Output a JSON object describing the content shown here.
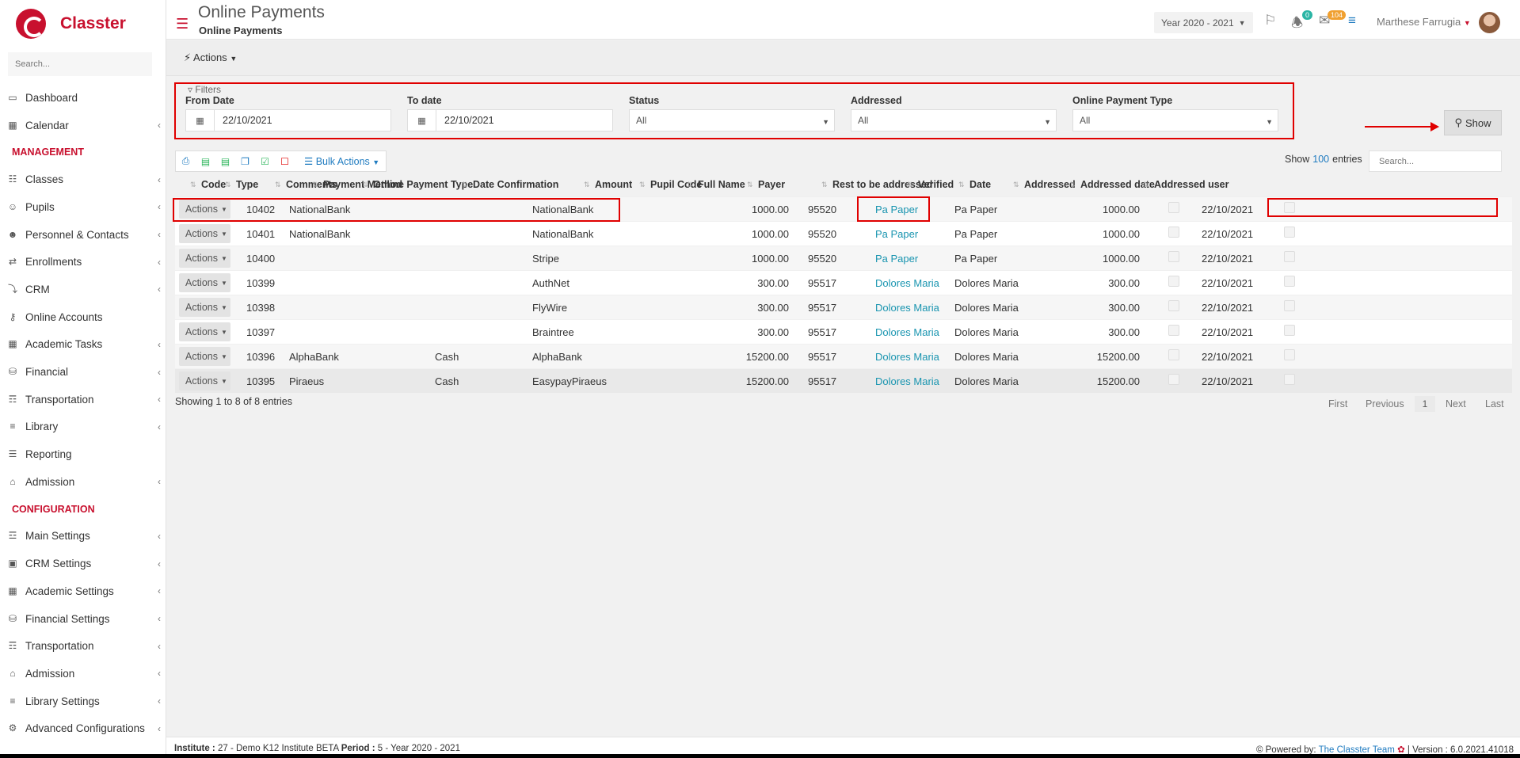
{
  "app": {
    "name": "Classter"
  },
  "sidebar": {
    "search_placeholder": "Search...",
    "management_title": "MANAGEMENT",
    "configuration_title": "CONFIGURATION",
    "items_top": [
      {
        "label": "Dashboard",
        "icon": "laptop-icon",
        "chev": false
      },
      {
        "label": "Calendar",
        "icon": "calendar-icon",
        "chev": true
      }
    ],
    "items_management": [
      {
        "label": "Classes",
        "icon": "classes-icon",
        "chev": true
      },
      {
        "label": "Pupils",
        "icon": "pupils-icon",
        "chev": true
      },
      {
        "label": "Personnel & Contacts",
        "icon": "personnel-icon",
        "chev": true
      },
      {
        "label": "Enrollments",
        "icon": "exchange-icon",
        "chev": true
      },
      {
        "label": "CRM",
        "icon": "crm-icon",
        "chev": true
      },
      {
        "label": "Online Accounts",
        "icon": "key-icon",
        "chev": false
      },
      {
        "label": "Academic Tasks",
        "icon": "grid-icon",
        "chev": true
      },
      {
        "label": "Financial",
        "icon": "coins-icon",
        "chev": true
      },
      {
        "label": "Transportation",
        "icon": "bus-icon",
        "chev": true
      },
      {
        "label": "Library",
        "icon": "books-icon",
        "chev": true
      },
      {
        "label": "Reporting",
        "icon": "report-icon",
        "chev": false
      },
      {
        "label": "Admission",
        "icon": "institution-icon",
        "chev": true
      }
    ],
    "items_configuration": [
      {
        "label": "Main Settings",
        "icon": "sliders-icon",
        "chev": true
      },
      {
        "label": "CRM Settings",
        "icon": "qr-icon",
        "chev": true
      },
      {
        "label": "Academic Settings",
        "icon": "grid-icon",
        "chev": true
      },
      {
        "label": "Financial Settings",
        "icon": "coins-icon",
        "chev": true
      },
      {
        "label": "Transportation",
        "icon": "bus-icon",
        "chev": true
      },
      {
        "label": "Admission",
        "icon": "institution-icon",
        "chev": true
      },
      {
        "label": "Library Settings",
        "icon": "books-icon",
        "chev": true
      },
      {
        "label": "Advanced Configurations",
        "icon": "cogs-icon",
        "chev": true
      }
    ]
  },
  "header": {
    "title": "Online Payments",
    "subtitle": "Online Payments",
    "year": "Year 2020 - 2021",
    "notifications_count": "0",
    "messages_count": "104",
    "user_name": "Marthese Farrugia"
  },
  "actions_label": "Actions",
  "filters": {
    "label": "Filters",
    "from_date_label": "From Date",
    "from_date_value": "22/10/2021",
    "to_date_label": "To date",
    "to_date_value": "22/10/2021",
    "status_label": "Status",
    "status_value": "All",
    "addressed_label": "Addressed",
    "addressed_value": "All",
    "type_label": "Online Payment Type",
    "type_value": "All",
    "show_label": "Show"
  },
  "toolbar": {
    "bulk_actions": "Bulk Actions",
    "show_prefix": "Show",
    "show_count": "100",
    "show_suffix": "entries",
    "search_placeholder": "Search..."
  },
  "table": {
    "columns": [
      "Code",
      "Type",
      "Comments",
      "Payment Method",
      "Online Payment Type",
      "Date Confirmation",
      "Amount",
      "Pupil Code",
      "Full Name",
      "Payer",
      "Rest to be addressed",
      "Verified",
      "Date",
      "Addressed",
      "Addressed date",
      "Addressed user"
    ],
    "row_action": "Actions",
    "rows": [
      {
        "code": "10402",
        "type": "NationalBank",
        "method": "",
        "opt": "NationalBank",
        "amount": "1000.00",
        "pupil": "95520",
        "name": "Pa Paper",
        "payer": "Pa Paper",
        "rest": "1000.00",
        "date": "22/10/2021"
      },
      {
        "code": "10401",
        "type": "NationalBank",
        "method": "",
        "opt": "NationalBank",
        "amount": "1000.00",
        "pupil": "95520",
        "name": "Pa Paper",
        "payer": "Pa Paper",
        "rest": "1000.00",
        "date": "22/10/2021"
      },
      {
        "code": "10400",
        "type": "",
        "method": "",
        "opt": "Stripe",
        "amount": "1000.00",
        "pupil": "95520",
        "name": "Pa Paper",
        "payer": "Pa Paper",
        "rest": "1000.00",
        "date": "22/10/2021"
      },
      {
        "code": "10399",
        "type": "",
        "method": "",
        "opt": "AuthNet",
        "amount": "300.00",
        "pupil": "95517",
        "name": "Dolores Maria",
        "payer": "Dolores Maria",
        "rest": "300.00",
        "date": "22/10/2021"
      },
      {
        "code": "10398",
        "type": "",
        "method": "",
        "opt": "FlyWire",
        "amount": "300.00",
        "pupil": "95517",
        "name": "Dolores Maria",
        "payer": "Dolores Maria",
        "rest": "300.00",
        "date": "22/10/2021"
      },
      {
        "code": "10397",
        "type": "",
        "method": "",
        "opt": "Braintree",
        "amount": "300.00",
        "pupil": "95517",
        "name": "Dolores Maria",
        "payer": "Dolores Maria",
        "rest": "300.00",
        "date": "22/10/2021"
      },
      {
        "code": "10396",
        "type": "AlphaBank",
        "method": "Cash",
        "opt": "AlphaBank",
        "amount": "15200.00",
        "pupil": "95517",
        "name": "Dolores Maria",
        "payer": "Dolores Maria",
        "rest": "15200.00",
        "date": "22/10/2021"
      },
      {
        "code": "10395",
        "type": "Piraeus",
        "method": "Cash",
        "opt": "EasypayPiraeus",
        "amount": "15200.00",
        "pupil": "95517",
        "name": "Dolores Maria",
        "payer": "Dolores Maria",
        "rest": "15200.00",
        "date": "22/10/2021"
      }
    ],
    "showing_text": "Showing 1 to 8 of 8 entries"
  },
  "pager": {
    "first": "First",
    "previous": "Previous",
    "current": "1",
    "next": "Next",
    "last": "Last"
  },
  "footer": {
    "institute_label": "Institute :",
    "institute_value": "27 - Demo K12 Institute BETA",
    "period_label": "Period :",
    "period_value": "5 - Year 2020 - 2021",
    "powered_label": "Powered by:",
    "powered_link": "The Classter Team",
    "version": "| Version : 6.0.2021.41018"
  },
  "colors": {
    "brand": "#c8102e",
    "link": "#1a95b0",
    "annotation": "#e00000"
  }
}
